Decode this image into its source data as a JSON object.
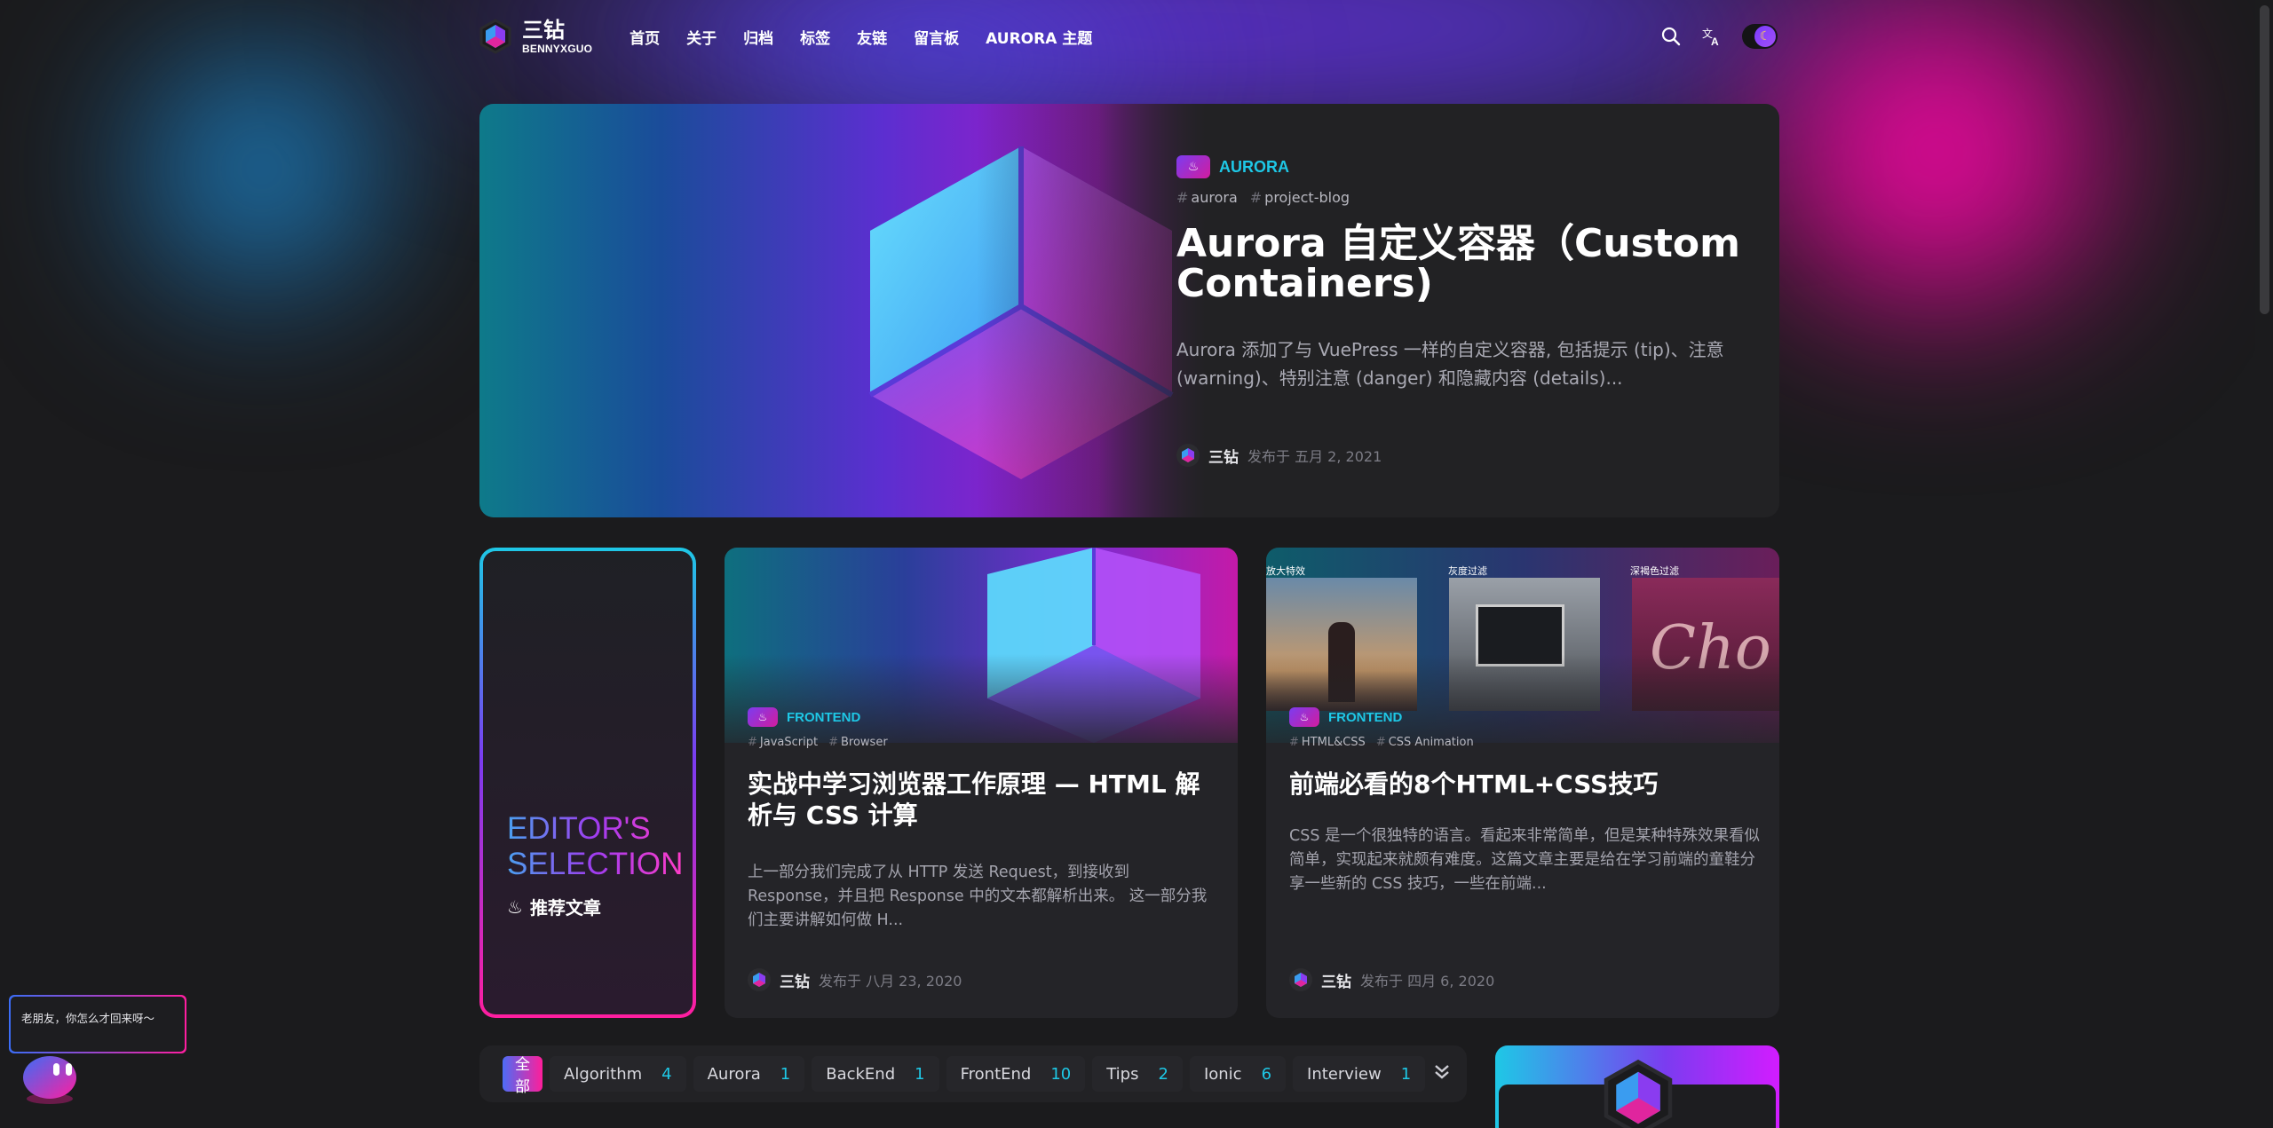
{
  "header": {
    "logo_title": "三钻",
    "logo_subtitle": "BENNYXGUO",
    "nav": [
      "首页",
      "关于",
      "归档",
      "标签",
      "友链",
      "留言板",
      "AURORA 主题"
    ],
    "search_icon": "search-icon",
    "translate_icon": "translate-icon",
    "theme_toggle_icon": "moon-icon"
  },
  "hero": {
    "category": "AURORA",
    "tags": [
      "aurora",
      "project-blog"
    ],
    "title": "Aurora 自定义容器（Custom Containers)",
    "description": "Aurora 添加了与 VuePress 一样的自定义容器, 包括提示 (tip)、注意 (warning)、特别注意 (danger) 和隐藏内容 (details)...",
    "author": "三钻",
    "published": "发布于 五月 2, 2021"
  },
  "editor": {
    "line1": "EDITOR'S",
    "line2": "SELECTION",
    "subtitle": "推荐文章"
  },
  "cards": [
    {
      "category": "FRONTEND",
      "tags": [
        "JavaScript",
        "Browser"
      ],
      "title": "实战中学习浏览器工作原理 — HTML 解析与 CSS 计算",
      "description": "上一部分我们完成了从 HTTP 发送 Request，到接收到 Response，并且把 Response 中的文本都解析出来。 这一部分我们主要讲解如何做 H...",
      "author": "三钻",
      "published": "发布于 八月 23, 2020"
    },
    {
      "category": "FRONTEND",
      "tags": [
        "HTML&CSS",
        "CSS Animation"
      ],
      "image_labels": [
        "放大特效",
        "灰度过滤",
        "深褐色过滤"
      ],
      "title": "前端必看的8个HTML+CSS技巧",
      "description": "CSS 是一个很独特的语言。看起来非常简单，但是某种特殊效果看似简单，实现起来就颇有难度。这篇文章主要是给在学习前端的童鞋分享一些新的 CSS 技巧，一些在前端...",
      "author": "三钻",
      "published": "发布于 四月 6, 2020"
    }
  ],
  "category_bar": {
    "all_label": "全部",
    "items": [
      {
        "label": "Algorithm",
        "count": "4"
      },
      {
        "label": "Aurora",
        "count": "1"
      },
      {
        "label": "BackEnd",
        "count": "1"
      },
      {
        "label": "FrontEnd",
        "count": "10"
      },
      {
        "label": "Tips",
        "count": "2"
      },
      {
        "label": "Ionic",
        "count": "6"
      },
      {
        "label": "Interview",
        "count": "1"
      }
    ],
    "expand_icon": "double-chevron-down-icon"
  },
  "chatbot": {
    "message": "老朋友，你怎么才回来呀～"
  },
  "colors": {
    "accent_cyan": "#1ec8e6",
    "accent_pink": "#ff1ea0",
    "accent_purple": "#7b3cf0",
    "background": "#1b1b1d"
  }
}
